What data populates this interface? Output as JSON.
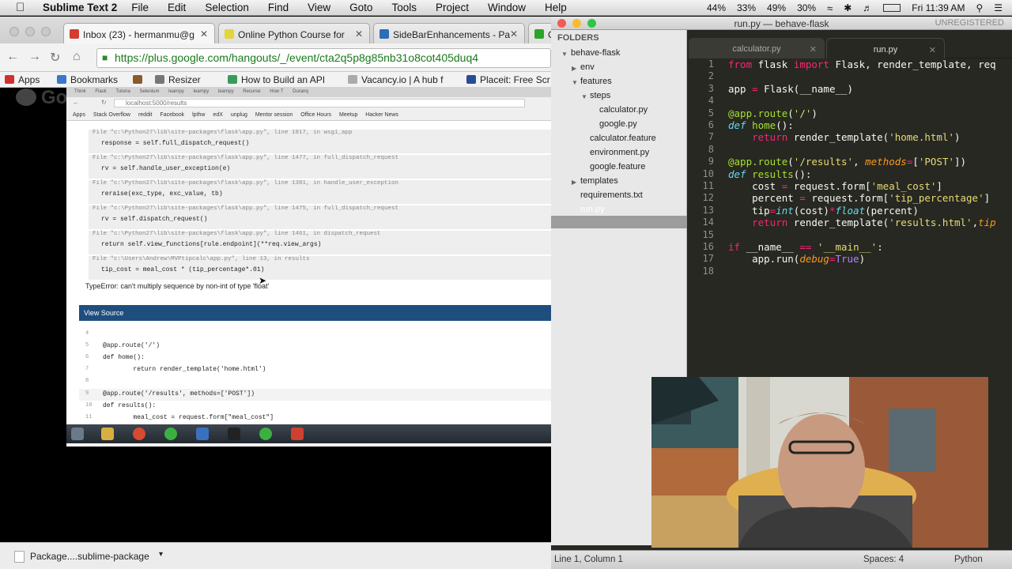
{
  "menubar": {
    "app_name": "Sublime Text 2",
    "items": [
      "File",
      "Edit",
      "Selection",
      "Find",
      "View",
      "Goto",
      "Tools",
      "Project",
      "Window",
      "Help"
    ],
    "status": [
      "44%",
      "33%",
      "49%",
      "30%",
      "Fri 11:39 AM"
    ]
  },
  "chrome": {
    "tabs": [
      "Inbox (23) - hermanmu@g",
      "Online Python Course for",
      "SideBarEnhancements - Pa",
      "G"
    ],
    "url": "https://plus.google.com/hangouts/_/event/cta2q5p8g85nb31o8cot405duq4",
    "bookmarks": [
      "Apps",
      "Bookmarks",
      "Resizer",
      "How to Build an API",
      "Vacancy.io | A hub f",
      "Placeit: Free Scr"
    ],
    "hangout_logo": "Google",
    "download": "Package....sublime-package"
  },
  "shared": {
    "tabs": [
      "Think",
      "Flask",
      "Tutoria",
      "Selenium",
      "learnpy",
      "learnpy",
      "learnpy",
      "Recurse",
      "How T",
      "Duranq"
    ],
    "url": "localhost:5000/results",
    "bookmarks": [
      "Apps",
      "Stack Overflow",
      "reddit",
      "Facebook",
      "lpthw",
      "edX",
      "unplug",
      "Mentor session",
      "Office Hours",
      "Meetup",
      "Hacker News"
    ],
    "traceback": [
      {
        "file": "File \"c:\\Python27\\lib\\site-packages\\flask\\app.py\", line 1817, in wsgi_app",
        "code": "response = self.full_dispatch_request()"
      },
      {
        "file": "File \"c:\\Python27\\lib\\site-packages\\flask\\app.py\", line 1477, in full_dispatch_request",
        "code": "rv = self.handle_user_exception(e)"
      },
      {
        "file": "File \"c:\\Python27\\lib\\site-packages\\flask\\app.py\", line 1381, in handle_user_exception",
        "code": "reraise(exc_type, exc_value, tb)"
      },
      {
        "file": "File \"c:\\Python27\\lib\\site-packages\\flask\\app.py\", line 1475, in full_dispatch_request",
        "code": "rv = self.dispatch_request()"
      },
      {
        "file": "File \"c:\\Python27\\lib\\site-packages\\flask\\app.py\", line 1461, in dispatch_request",
        "code": "return self.view_functions[rule.endpoint](**req.view_args)"
      },
      {
        "file": "File \"c:\\Users\\Andrew\\MVPtipcalc\\app.py\", line 13, in results",
        "code": "tip_cost = meal_cost * (tip_percentage*.01)"
      }
    ],
    "error": "TypeError: can't multiply sequence by non-int of type 'float'",
    "view_source": "View Source",
    "source_lines": [
      {
        "n": "4",
        "code": ""
      },
      {
        "n": "5",
        "code": "@app.route('/')"
      },
      {
        "n": "6",
        "code": "def home():"
      },
      {
        "n": "7",
        "code": "        return render_template('home.html')"
      },
      {
        "n": "8",
        "code": ""
      },
      {
        "n": "9",
        "code": "@app.route('/results', methods=['POST'])"
      },
      {
        "n": "10",
        "code": "def results():"
      },
      {
        "n": "11",
        "code": "        meal_cost = request.form[\"meal_cost\"]"
      }
    ]
  },
  "sublime": {
    "title": "run.py — behave-flask",
    "unregistered": "UNREGISTERED",
    "folders_header": "FOLDERS",
    "tree": [
      "behave-flask",
      "env",
      "features",
      "steps",
      "calculator.py",
      "google.py",
      "calculator.feature",
      "environment.py",
      "google.feature",
      "templates",
      "requirements.txt",
      "run.py"
    ],
    "tabs": [
      "calculator.py",
      "run.py"
    ],
    "status_left": "Line 1, Column 1",
    "status_spaces": "Spaces: 4",
    "status_syntax": "Python"
  }
}
